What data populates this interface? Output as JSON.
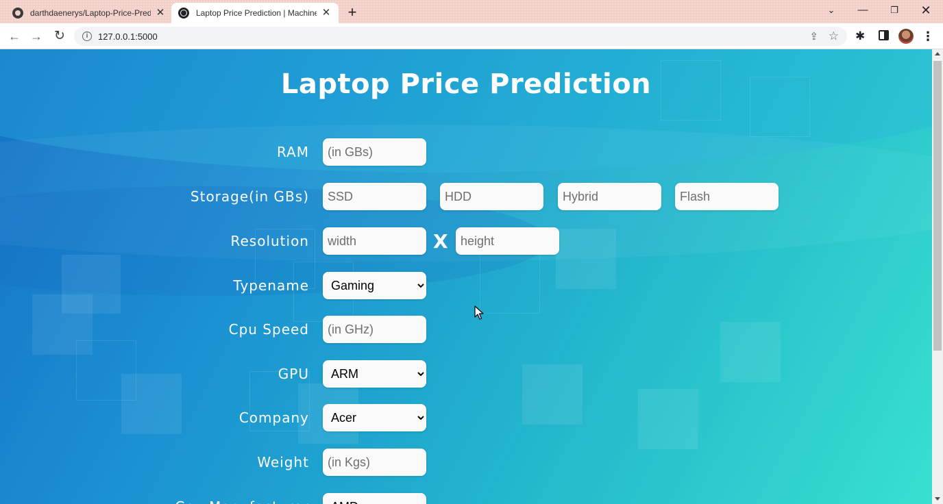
{
  "browser": {
    "tabs": [
      {
        "title": "darthdaenerys/Laptop-Price-Prediction",
        "active": false
      },
      {
        "title": "Laptop Price Prediction | Machine Learning",
        "active": true
      }
    ],
    "new_tab_label": "+",
    "url": "127.0.0.1:5000"
  },
  "page": {
    "title": "Laptop Price Prediction",
    "colors": {
      "gradient_start": "#1471c6",
      "gradient_end": "#38e0d0",
      "text": "#ffffff"
    }
  },
  "form": {
    "ram": {
      "label": "RAM",
      "placeholder": "(in GBs)"
    },
    "storage": {
      "label": "Storage(in GBs)",
      "ssd_placeholder": "SSD",
      "hdd_placeholder": "HDD",
      "hybrid_placeholder": "Hybrid",
      "flash_placeholder": "Flash"
    },
    "resolution": {
      "label": "Resolution",
      "width_placeholder": "width",
      "separator": "X",
      "height_placeholder": "height"
    },
    "typename": {
      "label": "Typename",
      "selected": "Gaming"
    },
    "cpu_speed": {
      "label": "Cpu Speed",
      "placeholder": "(in GHz)"
    },
    "gpu": {
      "label": "GPU",
      "selected": "ARM"
    },
    "company": {
      "label": "Company",
      "selected": "Acer"
    },
    "weight": {
      "label": "Weight",
      "placeholder": "(in Kgs)"
    },
    "cpu_manufacturer": {
      "label": "Cpu Manufacturer",
      "selected": "AMD"
    }
  }
}
